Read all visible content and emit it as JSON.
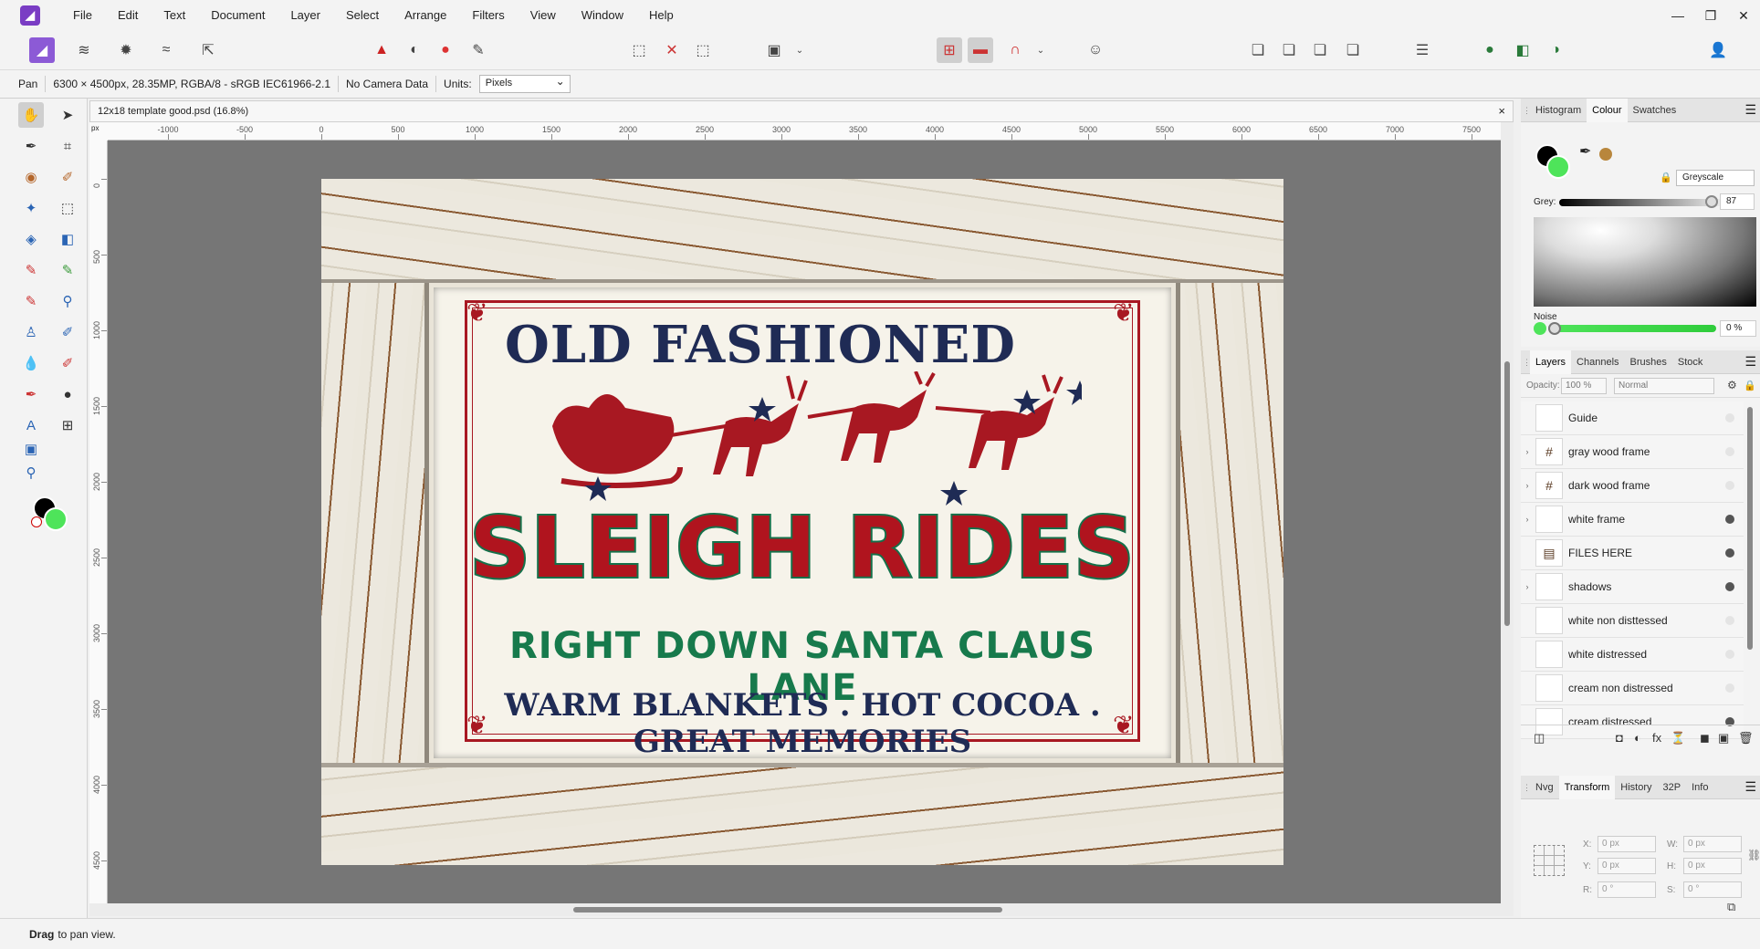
{
  "menu": {
    "items": [
      "File",
      "Edit",
      "Text",
      "Document",
      "Layer",
      "Select",
      "Arrange",
      "Filters",
      "View",
      "Window",
      "Help"
    ]
  },
  "window": {
    "controls": [
      "—",
      "❐",
      "✕"
    ]
  },
  "context": {
    "tool": "Pan",
    "doc_info": "6300 × 4500px, 28.35MP, RGBA/8 - sRGB IEC61966-2.1",
    "camera": "No Camera Data",
    "units_label": "Units:",
    "units_value": "Pixels"
  },
  "document": {
    "tab_title": "12x18 template good.psd (16.8%)",
    "close": "×",
    "ruler_unit": "px",
    "ruler_top_labels": [
      "-1000",
      "-500",
      "0",
      "500",
      "1000",
      "1500",
      "2000",
      "2500",
      "3000",
      "3500",
      "4000",
      "4500",
      "5000",
      "5500",
      "6000",
      "6500",
      "7000",
      "7500"
    ],
    "ruler_left_labels": [
      "0",
      "500",
      "1000",
      "1500",
      "2000",
      "2500",
      "3000",
      "3500",
      "4000",
      "4500"
    ]
  },
  "artwork": {
    "line1": "OLD FASHIONED",
    "line2": "SLEIGH RIDES",
    "line3": "RIGHT DOWN SANTA CLAUS LANE",
    "line4": "WARM BLANKETS . HOT COCOA . GREAT MEMORIES",
    "colors": {
      "navy": "#1f2b55",
      "red": "#b0141e",
      "green": "#177a4c",
      "cream": "#f6f3ea"
    }
  },
  "colour_panel": {
    "tabs": [
      "Histogram",
      "Colour",
      "Swatches"
    ],
    "active_tab": "Colour",
    "mode": "Greyscale",
    "grey_label": "Grey:",
    "grey_value": "87",
    "grey_fraction": 0.87,
    "noise_label": "Noise",
    "noise_value": "0 %"
  },
  "layers_panel": {
    "tabs": [
      "Layers",
      "Channels",
      "Brushes",
      "Stock"
    ],
    "active_tab": "Layers",
    "opacity_label": "Opacity:",
    "opacity_value": "100 %",
    "blend_mode": "Normal",
    "layers": [
      {
        "name": "Guide",
        "expand": "",
        "thumb": "",
        "visible": false
      },
      {
        "name": "gray wood frame",
        "expand": "›",
        "thumb": "#",
        "visible": false
      },
      {
        "name": "dark wood frame",
        "expand": "›",
        "thumb": "#",
        "visible": false
      },
      {
        "name": "white frame",
        "expand": "›",
        "thumb": "",
        "visible": true
      },
      {
        "name": "FILES HERE",
        "expand": "",
        "thumb": "▤",
        "visible": true
      },
      {
        "name": "shadows",
        "expand": "›",
        "thumb": "",
        "visible": true
      },
      {
        "name": "white non disttessed",
        "expand": "",
        "thumb": "",
        "visible": false
      },
      {
        "name": "white distressed",
        "expand": "",
        "thumb": "",
        "visible": false
      },
      {
        "name": "cream non distressed",
        "expand": "",
        "thumb": "",
        "visible": false
      },
      {
        "name": "cream distressed",
        "expand": "",
        "thumb": "",
        "visible": true
      }
    ]
  },
  "transform_panel": {
    "tabs": [
      "Nvg",
      "Transform",
      "History",
      "32P",
      "Info"
    ],
    "active_tab": "Transform",
    "x_label": "X:",
    "x_value": "0 px",
    "y_label": "Y:",
    "y_value": "0 px",
    "w_label": "W:",
    "w_value": "0 px",
    "h_label": "H:",
    "h_value": "0 px",
    "r_label": "R:",
    "r_value": "0 °",
    "s_label": "S:",
    "s_value": "0 °"
  },
  "status": {
    "bold": "Drag",
    "text": "to pan view."
  }
}
